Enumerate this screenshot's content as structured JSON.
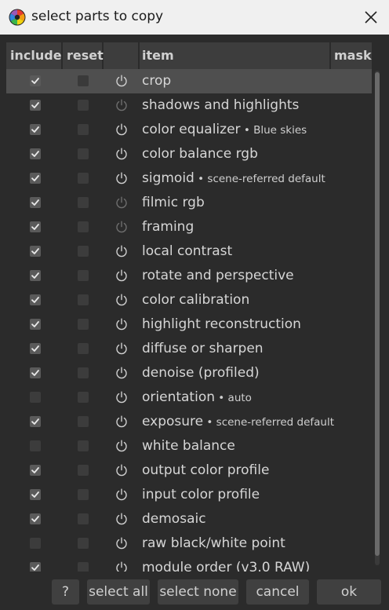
{
  "window": {
    "title": "select parts to copy"
  },
  "header": {
    "include": "include",
    "reset": "reset",
    "icon_col": "",
    "item": "item",
    "mask": "mask"
  },
  "rows": [
    {
      "label": "crop",
      "sub": "",
      "include": true,
      "power": "on",
      "selected": true
    },
    {
      "label": "shadows and highlights",
      "sub": "",
      "include": true,
      "power": "dim"
    },
    {
      "label": "color equalizer",
      "sub": " • Blue skies",
      "include": true,
      "power": "on"
    },
    {
      "label": "color balance rgb",
      "sub": "",
      "include": true,
      "power": "on"
    },
    {
      "label": "sigmoid",
      "sub": " • scene-referred default",
      "include": true,
      "power": "on"
    },
    {
      "label": "filmic rgb",
      "sub": "",
      "include": true,
      "power": "dim"
    },
    {
      "label": "framing",
      "sub": "",
      "include": true,
      "power": "dim"
    },
    {
      "label": "local contrast",
      "sub": "",
      "include": true,
      "power": "on"
    },
    {
      "label": "rotate and perspective",
      "sub": "",
      "include": true,
      "power": "on"
    },
    {
      "label": "color calibration",
      "sub": "",
      "include": true,
      "power": "on"
    },
    {
      "label": "highlight reconstruction",
      "sub": "",
      "include": true,
      "power": "on"
    },
    {
      "label": "diffuse or sharpen",
      "sub": "",
      "include": true,
      "power": "on"
    },
    {
      "label": "denoise (profiled)",
      "sub": "",
      "include": true,
      "power": "on"
    },
    {
      "label": "orientation",
      "sub": " • auto",
      "include": false,
      "power": "on"
    },
    {
      "label": "exposure",
      "sub": " • scene-referred default",
      "include": true,
      "power": "on"
    },
    {
      "label": "white balance",
      "sub": "",
      "include": false,
      "power": "on"
    },
    {
      "label": "output color profile",
      "sub": "",
      "include": true,
      "power": "on"
    },
    {
      "label": "input color profile",
      "sub": "",
      "include": true,
      "power": "on"
    },
    {
      "label": "demosaic",
      "sub": "",
      "include": true,
      "power": "on"
    },
    {
      "label": "raw black/white point",
      "sub": "",
      "include": false,
      "power": "on"
    },
    {
      "label": "module order (v3.0 RAW)",
      "sub": "",
      "include": true,
      "power": "on"
    }
  ],
  "footer": {
    "help": "?",
    "select_all": "select all",
    "select_none": "select none",
    "cancel": "cancel",
    "ok": "ok"
  },
  "colors": {
    "background": "#2b2b2b",
    "header": "#3d3d3d",
    "selected_row": "#4f4f4f",
    "text": "#d6d6d6",
    "button": "#404040",
    "titlebar": "#f0f0f0"
  },
  "icons": {
    "app": "darktable-aperture-icon",
    "close": "close-icon",
    "power": "power-icon",
    "check": "checkmark-icon"
  }
}
